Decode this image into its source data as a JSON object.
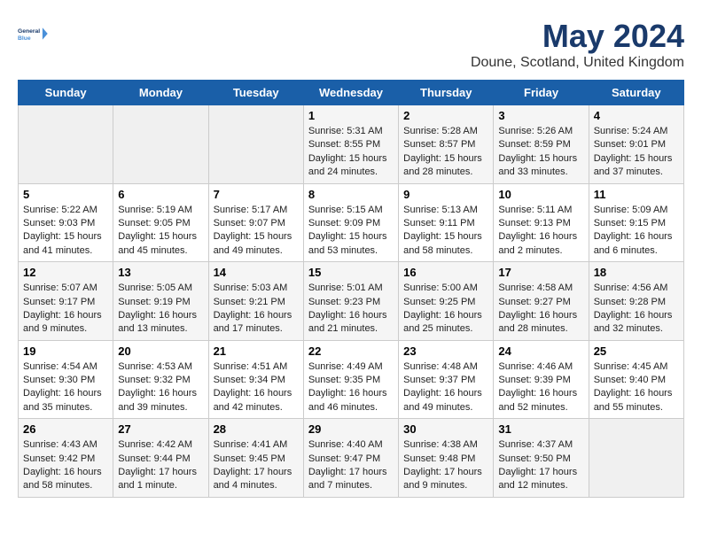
{
  "header": {
    "logo_line1": "General",
    "logo_line2": "Blue",
    "month_title": "May 2024",
    "location": "Doune, Scotland, United Kingdom"
  },
  "days_of_week": [
    "Sunday",
    "Monday",
    "Tuesday",
    "Wednesday",
    "Thursday",
    "Friday",
    "Saturday"
  ],
  "weeks": [
    [
      {
        "day": "",
        "info": ""
      },
      {
        "day": "",
        "info": ""
      },
      {
        "day": "",
        "info": ""
      },
      {
        "day": "1",
        "info": "Sunrise: 5:31 AM\nSunset: 8:55 PM\nDaylight: 15 hours\nand 24 minutes."
      },
      {
        "day": "2",
        "info": "Sunrise: 5:28 AM\nSunset: 8:57 PM\nDaylight: 15 hours\nand 28 minutes."
      },
      {
        "day": "3",
        "info": "Sunrise: 5:26 AM\nSunset: 8:59 PM\nDaylight: 15 hours\nand 33 minutes."
      },
      {
        "day": "4",
        "info": "Sunrise: 5:24 AM\nSunset: 9:01 PM\nDaylight: 15 hours\nand 37 minutes."
      }
    ],
    [
      {
        "day": "5",
        "info": "Sunrise: 5:22 AM\nSunset: 9:03 PM\nDaylight: 15 hours\nand 41 minutes."
      },
      {
        "day": "6",
        "info": "Sunrise: 5:19 AM\nSunset: 9:05 PM\nDaylight: 15 hours\nand 45 minutes."
      },
      {
        "day": "7",
        "info": "Sunrise: 5:17 AM\nSunset: 9:07 PM\nDaylight: 15 hours\nand 49 minutes."
      },
      {
        "day": "8",
        "info": "Sunrise: 5:15 AM\nSunset: 9:09 PM\nDaylight: 15 hours\nand 53 minutes."
      },
      {
        "day": "9",
        "info": "Sunrise: 5:13 AM\nSunset: 9:11 PM\nDaylight: 15 hours\nand 58 minutes."
      },
      {
        "day": "10",
        "info": "Sunrise: 5:11 AM\nSunset: 9:13 PM\nDaylight: 16 hours\nand 2 minutes."
      },
      {
        "day": "11",
        "info": "Sunrise: 5:09 AM\nSunset: 9:15 PM\nDaylight: 16 hours\nand 6 minutes."
      }
    ],
    [
      {
        "day": "12",
        "info": "Sunrise: 5:07 AM\nSunset: 9:17 PM\nDaylight: 16 hours\nand 9 minutes."
      },
      {
        "day": "13",
        "info": "Sunrise: 5:05 AM\nSunset: 9:19 PM\nDaylight: 16 hours\nand 13 minutes."
      },
      {
        "day": "14",
        "info": "Sunrise: 5:03 AM\nSunset: 9:21 PM\nDaylight: 16 hours\nand 17 minutes."
      },
      {
        "day": "15",
        "info": "Sunrise: 5:01 AM\nSunset: 9:23 PM\nDaylight: 16 hours\nand 21 minutes."
      },
      {
        "day": "16",
        "info": "Sunrise: 5:00 AM\nSunset: 9:25 PM\nDaylight: 16 hours\nand 25 minutes."
      },
      {
        "day": "17",
        "info": "Sunrise: 4:58 AM\nSunset: 9:27 PM\nDaylight: 16 hours\nand 28 minutes."
      },
      {
        "day": "18",
        "info": "Sunrise: 4:56 AM\nSunset: 9:28 PM\nDaylight: 16 hours\nand 32 minutes."
      }
    ],
    [
      {
        "day": "19",
        "info": "Sunrise: 4:54 AM\nSunset: 9:30 PM\nDaylight: 16 hours\nand 35 minutes."
      },
      {
        "day": "20",
        "info": "Sunrise: 4:53 AM\nSunset: 9:32 PM\nDaylight: 16 hours\nand 39 minutes."
      },
      {
        "day": "21",
        "info": "Sunrise: 4:51 AM\nSunset: 9:34 PM\nDaylight: 16 hours\nand 42 minutes."
      },
      {
        "day": "22",
        "info": "Sunrise: 4:49 AM\nSunset: 9:35 PM\nDaylight: 16 hours\nand 46 minutes."
      },
      {
        "day": "23",
        "info": "Sunrise: 4:48 AM\nSunset: 9:37 PM\nDaylight: 16 hours\nand 49 minutes."
      },
      {
        "day": "24",
        "info": "Sunrise: 4:46 AM\nSunset: 9:39 PM\nDaylight: 16 hours\nand 52 minutes."
      },
      {
        "day": "25",
        "info": "Sunrise: 4:45 AM\nSunset: 9:40 PM\nDaylight: 16 hours\nand 55 minutes."
      }
    ],
    [
      {
        "day": "26",
        "info": "Sunrise: 4:43 AM\nSunset: 9:42 PM\nDaylight: 16 hours\nand 58 minutes."
      },
      {
        "day": "27",
        "info": "Sunrise: 4:42 AM\nSunset: 9:44 PM\nDaylight: 17 hours\nand 1 minute."
      },
      {
        "day": "28",
        "info": "Sunrise: 4:41 AM\nSunset: 9:45 PM\nDaylight: 17 hours\nand 4 minutes."
      },
      {
        "day": "29",
        "info": "Sunrise: 4:40 AM\nSunset: 9:47 PM\nDaylight: 17 hours\nand 7 minutes."
      },
      {
        "day": "30",
        "info": "Sunrise: 4:38 AM\nSunset: 9:48 PM\nDaylight: 17 hours\nand 9 minutes."
      },
      {
        "day": "31",
        "info": "Sunrise: 4:37 AM\nSunset: 9:50 PM\nDaylight: 17 hours\nand 12 minutes."
      },
      {
        "day": "",
        "info": ""
      }
    ]
  ]
}
